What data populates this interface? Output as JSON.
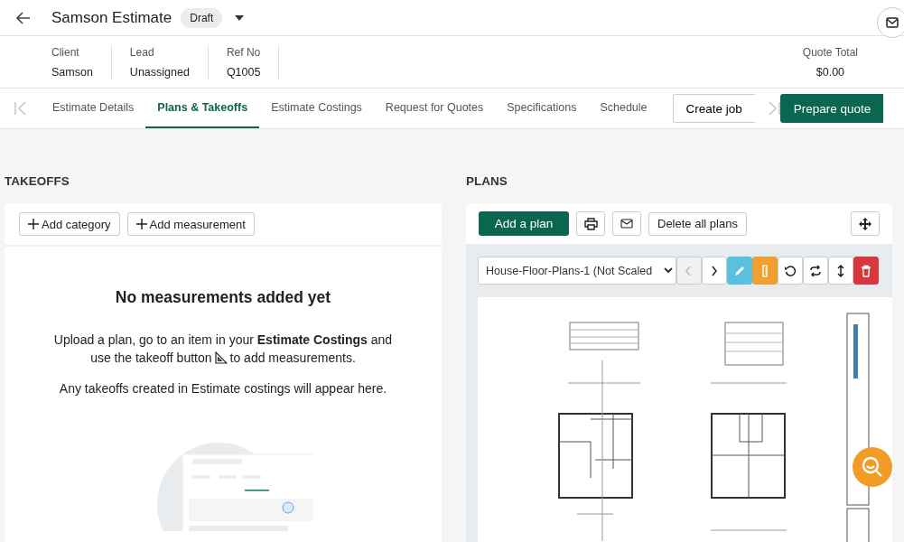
{
  "header": {
    "title": "Samson Estimate",
    "status": "Draft"
  },
  "info": {
    "fields": [
      {
        "label": "Client",
        "value": "Samson"
      },
      {
        "label": "Lead",
        "value": "Unassigned"
      },
      {
        "label": "Ref No",
        "value": "Q1005"
      }
    ],
    "quote_total": {
      "label": "Quote Total",
      "value": "$0.00"
    }
  },
  "tabs": [
    {
      "label": "Estimate Details",
      "selected": false
    },
    {
      "label": "Plans & Takeoffs",
      "selected": true
    },
    {
      "label": "Estimate Costings",
      "selected": false
    },
    {
      "label": "Request for Quotes",
      "selected": false
    },
    {
      "label": "Specifications",
      "selected": false
    },
    {
      "label": "Schedule",
      "selected": false
    }
  ],
  "create_job": "Create job",
  "prepare_quote": "Prepare quote",
  "takeoffs": {
    "heading": "TAKEOFFS",
    "buttons": [
      "Add category",
      "Add measurement"
    ],
    "empty_title": "No measurements added yet",
    "instruction_line": "Upload a plan, go to an item in your **Estimate Costings** and",
    "instruction_before": "use the takeoff button",
    "instruction_after": "to add measurements.",
    "note": "Any takeoffs created in Estimate costings will appear here."
  },
  "plans": {
    "heading": "PLANS",
    "add_button": "Add a plan",
    "delete_button": "Delete all plans",
    "plan_select": "House-Floor-Plans-1 (Not Scaled",
    "tools": [
      {
        "kind": "prev",
        "disabled": true
      },
      {
        "kind": "next",
        "disabled": false
      },
      {
        "kind": "edit",
        "disabled": false
      },
      {
        "kind": "ruler",
        "disabled": false
      },
      {
        "kind": "rotate",
        "disabled": false
      },
      {
        "kind": "swap",
        "disabled": false
      },
      {
        "kind": "resize",
        "disabled": false
      },
      {
        "kind": "delete",
        "disabled": false
      }
    ]
  }
}
